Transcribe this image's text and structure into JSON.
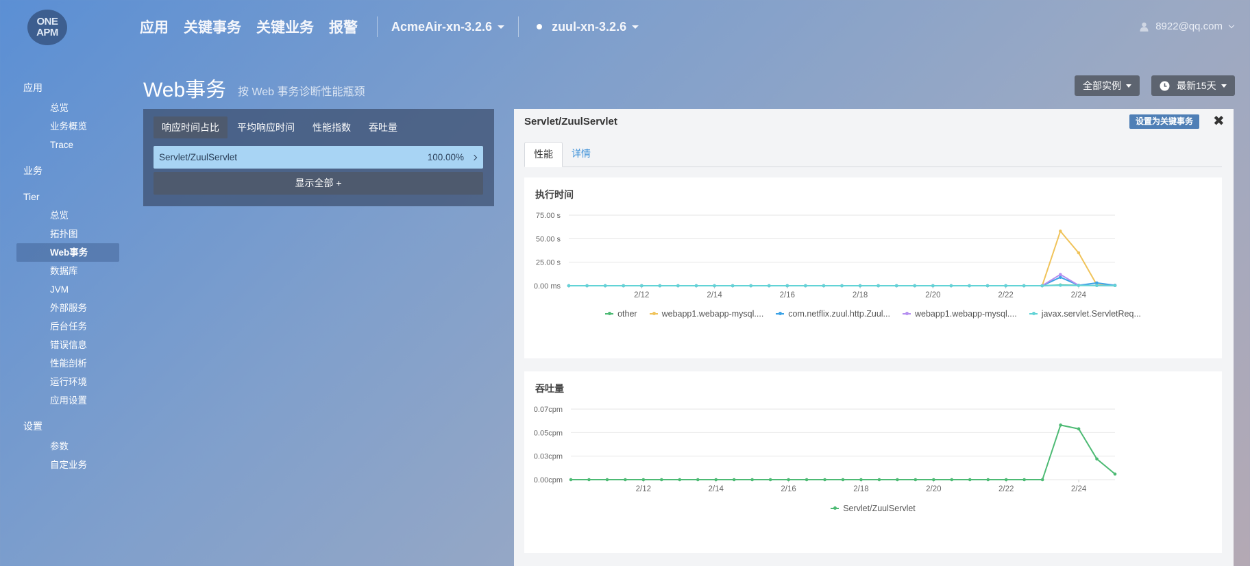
{
  "brand": {
    "logo_text": "ONE APM"
  },
  "topnav": {
    "items": [
      "应用",
      "关键事务",
      "关键业务",
      "报警"
    ],
    "app_select": "AcmeAir-xn-3.2.6",
    "tier_select": "zuul-xn-3.2.6"
  },
  "user": {
    "email": "8922@qq.com"
  },
  "sidebar": {
    "groups": [
      {
        "label": "应用",
        "items": [
          "总览",
          "业务概览",
          "Trace"
        ]
      },
      {
        "label": "业务",
        "items": []
      },
      {
        "label": "Tier",
        "items": [
          "总览",
          "拓扑图",
          "Web事务",
          "数据库",
          "JVM",
          "外部服务",
          "后台任务",
          "错误信息",
          "性能剖析",
          "运行环境",
          "应用设置"
        ]
      },
      {
        "label": "设置",
        "items": [
          "参数",
          "自定业务"
        ]
      }
    ],
    "active_item": "Web事务"
  },
  "header": {
    "title": "Web事务",
    "subtitle": "按 Web 事务诊断性能瓶颈",
    "instances_button": "全部实例",
    "time_button": "最新15天"
  },
  "left_panel": {
    "tabs": [
      "响应时间占比",
      "平均响应时间",
      "性能指数",
      "吞吐量"
    ],
    "active_tab": "响应时间占比",
    "row": {
      "name": "Servlet/ZuulServlet",
      "value": "100.00%"
    },
    "show_all": "显示全部 +"
  },
  "right_panel": {
    "title": "Servlet/ZuulServlet",
    "key_button": "设置为关键事务",
    "close": "✖",
    "tabs": [
      "性能",
      "详情"
    ],
    "active_tab": "性能"
  },
  "colors": {
    "other": "#4dba74",
    "webapp1_a": "#f0c35a",
    "netflix": "#3ba2e6",
    "webapp1_b": "#b58ff0",
    "javax": "#62d3d6",
    "throughput": "#4dba74"
  },
  "chart_data": [
    {
      "type": "line",
      "title": "执行时间",
      "x": [
        "2/10",
        "2/10.5",
        "2/11",
        "2/11.5",
        "2/12",
        "2/12.5",
        "2/13",
        "2/13.5",
        "2/14",
        "2/14.5",
        "2/15",
        "2/15.5",
        "2/16",
        "2/16.5",
        "2/17",
        "2/17.5",
        "2/18",
        "2/18.5",
        "2/19",
        "2/19.5",
        "2/20",
        "2/20.5",
        "2/21",
        "2/21.5",
        "2/22",
        "2/22.5",
        "2/23",
        "2/23.5",
        "2/24",
        "2/24.5",
        "2/25"
      ],
      "xticks": [
        "2/12",
        "2/14",
        "2/16",
        "2/18",
        "2/20",
        "2/22",
        "2/24"
      ],
      "yticks": [
        "0.00 ms",
        "25.00 s",
        "50.00 s",
        "75.00 s"
      ],
      "ylim": [
        0,
        75
      ],
      "series": [
        {
          "name": "other",
          "color": "#4dba74",
          "values": [
            0,
            0,
            0,
            0,
            0,
            0,
            0,
            0,
            0,
            0,
            0,
            0,
            0,
            0,
            0,
            0,
            0,
            0,
            0,
            0,
            0,
            0,
            0,
            0,
            0,
            0,
            0,
            0.8,
            0.5,
            0.3,
            0.2
          ]
        },
        {
          "name": "webapp1.webapp-mysql....",
          "color": "#f0c35a",
          "values": [
            0,
            0,
            0,
            0,
            0,
            0,
            0,
            0,
            0,
            0,
            0,
            0,
            0,
            0,
            0,
            0,
            0,
            0,
            0,
            0,
            0,
            0,
            0,
            0,
            0,
            0,
            0,
            58,
            35,
            1,
            0.5
          ]
        },
        {
          "name": "com.netflix.zuul.http.Zuul...",
          "color": "#3ba2e6",
          "values": [
            0,
            0,
            0,
            0,
            0,
            0,
            0,
            0,
            0,
            0,
            0,
            0,
            0,
            0,
            0,
            0,
            0,
            0,
            0,
            0,
            0,
            0,
            0,
            0,
            0,
            0,
            0,
            9,
            0.5,
            3,
            0.5
          ]
        },
        {
          "name": "webapp1.webapp-mysql....",
          "color": "#b58ff0",
          "values": [
            0,
            0,
            0,
            0,
            0,
            0,
            0,
            0,
            0,
            0,
            0,
            0,
            0,
            0,
            0,
            0,
            0,
            0,
            0,
            0,
            0,
            0,
            0,
            0,
            0,
            0,
            0,
            12,
            0.5,
            0.3,
            0.2
          ]
        },
        {
          "name": "javax.servlet.ServletReq...",
          "color": "#62d3d6",
          "values": [
            0,
            0,
            0,
            0,
            0,
            0,
            0,
            0,
            0,
            0,
            0,
            0,
            0,
            0,
            0,
            0,
            0,
            0,
            0,
            0,
            0,
            0,
            0,
            0,
            0,
            0,
            0,
            0.5,
            0.3,
            0.3,
            0.2
          ]
        }
      ],
      "legend": "bottom"
    },
    {
      "type": "line",
      "title": "吞吐量",
      "x": [
        "2/10",
        "2/10.5",
        "2/11",
        "2/11.5",
        "2/12",
        "2/12.5",
        "2/13",
        "2/13.5",
        "2/14",
        "2/14.5",
        "2/15",
        "2/15.5",
        "2/16",
        "2/16.5",
        "2/17",
        "2/17.5",
        "2/18",
        "2/18.5",
        "2/19",
        "2/19.5",
        "2/20",
        "2/20.5",
        "2/21",
        "2/21.5",
        "2/22",
        "2/22.5",
        "2/23",
        "2/23.5",
        "2/24",
        "2/24.5",
        "2/25"
      ],
      "xticks": [
        "2/12",
        "2/14",
        "2/16",
        "2/18",
        "2/20",
        "2/22",
        "2/24"
      ],
      "yticks": [
        "0.00cpm",
        "0.03cpm",
        "0.05cpm",
        "0.07cpm"
      ],
      "ylim": [
        0,
        0.075
      ],
      "series": [
        {
          "name": "Servlet/ZuulServlet",
          "color": "#4dba74",
          "values": [
            0,
            0,
            0,
            0,
            0,
            0,
            0,
            0,
            0,
            0,
            0,
            0,
            0,
            0,
            0,
            0,
            0,
            0,
            0,
            0,
            0,
            0,
            0,
            0,
            0,
            0,
            0,
            0.058,
            0.054,
            0.022,
            0.006
          ]
        }
      ],
      "legend": "bottom"
    }
  ]
}
